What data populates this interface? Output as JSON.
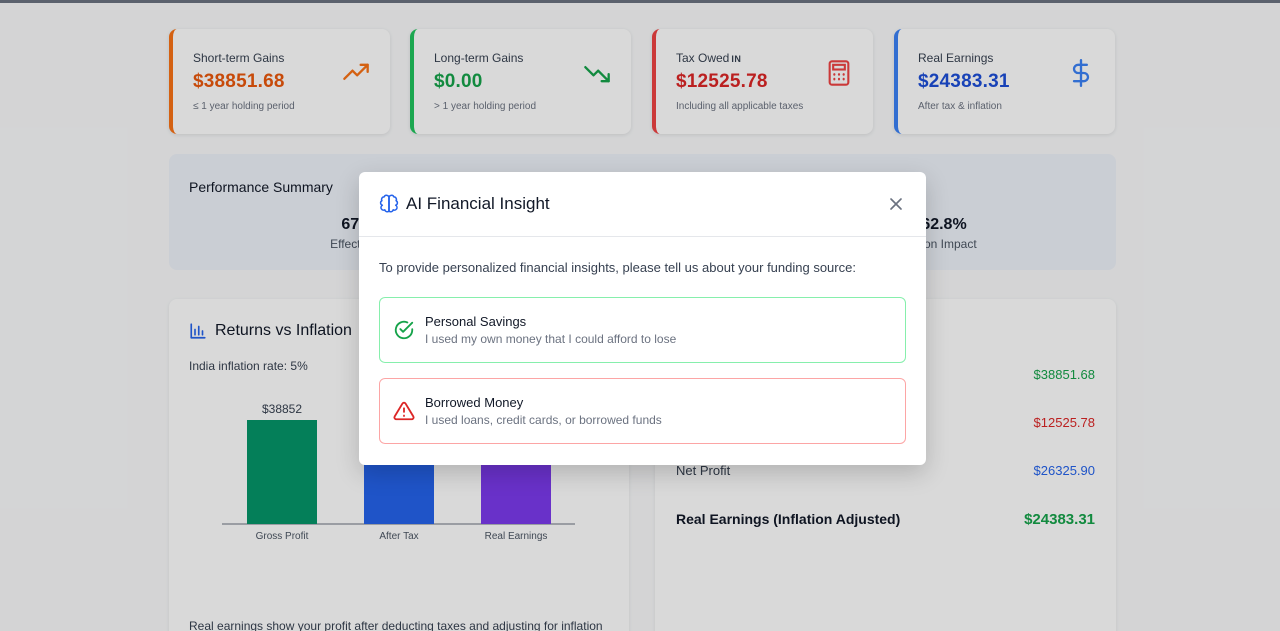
{
  "cards": [
    {
      "title": "Short-term Gains",
      "badge": "",
      "value": "$38851.68",
      "sub": "≤ 1 year holding period",
      "color": "#ea580c",
      "icon": "trending-up-icon"
    },
    {
      "title": "Long-term Gains",
      "badge": "",
      "value": "$0.00",
      "sub": "> 1 year holding period",
      "color": "#16a34a",
      "icon": "trending-down-icon"
    },
    {
      "title": "Tax Owed",
      "badge": "IN",
      "value": "$12525.78",
      "sub": "Including all applicable taxes",
      "color": "#dc2626",
      "icon": "calculator-icon"
    },
    {
      "title": "Real Earnings",
      "badge": "",
      "value": "$24383.31",
      "sub": "After tax & inflation",
      "color": "#1d4ed8",
      "icon": "dollar-icon"
    }
  ],
  "performance": {
    "title": "Performance Summary",
    "metrics": [
      {
        "value": "67.8%",
        "label": "Effective Ret"
      },
      {
        "value": "62.8%",
        "label": "ation Impact"
      }
    ]
  },
  "chart_panel": {
    "title": "Returns vs Inflation",
    "subtitle": "India inflation rate: 5%",
    "note": "Real earnings show your profit after deducting taxes and adjusting for inflation"
  },
  "chart_data": {
    "type": "bar",
    "categories": [
      "Gross Profit",
      "After Tax",
      "Real Earnings"
    ],
    "values": [
      38852,
      26326,
      24383
    ],
    "data_labels": [
      "$38852",
      "",
      ""
    ],
    "colors": [
      "#059669",
      "#2563eb",
      "#7c3aed"
    ],
    "ylim": [
      0,
      38852
    ]
  },
  "summary": {
    "rows": [
      {
        "label": "",
        "value": "$38851.68",
        "color": "#16a34a"
      },
      {
        "label": "",
        "value": "$12525.78",
        "color": "#dc2626"
      },
      {
        "label": "Net Profit",
        "value": "$26325.90",
        "color": "#2563eb"
      },
      {
        "label": "Real Earnings (Inflation Adjusted)",
        "value": "$24383.31",
        "color": "#16a34a"
      }
    ]
  },
  "modal": {
    "title": "AI Financial Insight",
    "prompt": "To provide personalized financial insights, please tell us about your funding source:",
    "options": [
      {
        "title": "Personal Savings",
        "desc": "I used my own money that I could afford to lose",
        "color": "#16a34a"
      },
      {
        "title": "Borrowed Money",
        "desc": "I used loans, credit cards, or borrowed funds",
        "color": "#dc2626"
      }
    ]
  }
}
